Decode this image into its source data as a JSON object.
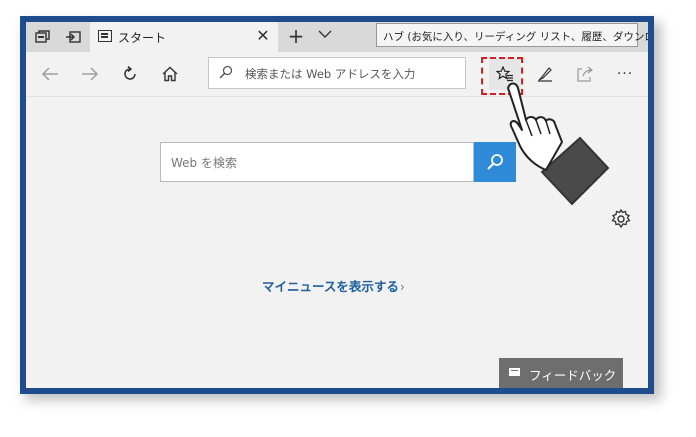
{
  "tabbar": {
    "tab_title": "スタート",
    "close_glyph": "✕",
    "new_tab_glyph": "+",
    "tab_menu_glyph": "⌵",
    "tooltip": "ハブ (お気に入り、リーディング リスト、履歴、ダウンロード)"
  },
  "navbar": {
    "address_placeholder": "検索または Web アドレスを入力",
    "more_glyph": "···"
  },
  "content": {
    "search_placeholder": "Web を検索",
    "my_news_label": "マイニュースを表示する",
    "my_news_chevron": "›"
  },
  "feedback": {
    "label": "フィードバック"
  },
  "colors": {
    "window_border": "#1f4c8c",
    "search_button": "#2f8ad8",
    "highlight": "#d42020",
    "link": "#1b5fa0",
    "feedback_bg": "#6e6e6e"
  },
  "icons": [
    "tab-preview-icon",
    "tab-setaside-icon",
    "back-arrow-icon",
    "forward-arrow-icon",
    "refresh-icon",
    "home-icon",
    "search-icon",
    "hub-star-icon",
    "web-note-pen-icon",
    "share-icon",
    "more-dots-icon",
    "settings-gear-icon",
    "feedback-icon",
    "pointing-hand-icon"
  ]
}
